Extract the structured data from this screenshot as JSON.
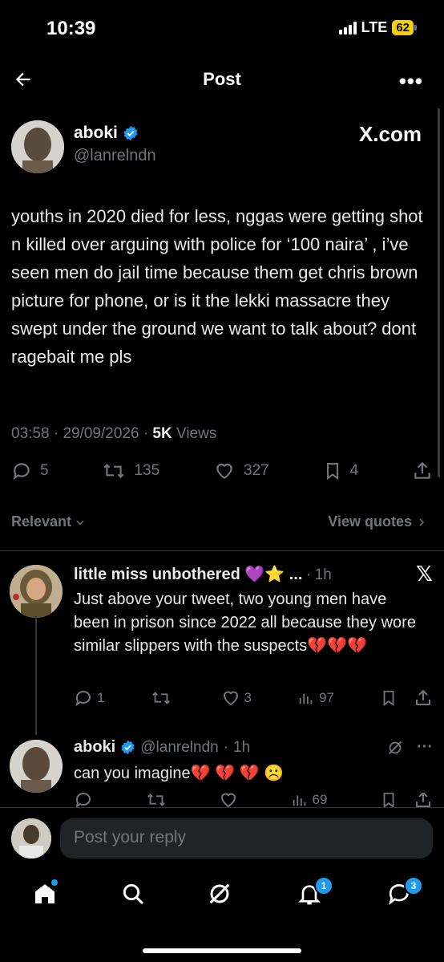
{
  "status": {
    "time": "10:39",
    "network": "LTE",
    "battery": "62"
  },
  "header": {
    "title": "Post"
  },
  "post": {
    "author_name": "aboki",
    "author_handle": "@lanrelndn",
    "source_badge": "X.com",
    "text": "youths in 2020 died for less, nggas were getting shot n killed over arguing with police for ‘100 naira’ , i’ve seen men do jail time because them get chris brown picture for phone, or is it the lekki massacre they swept under the ground we want to talk about? dont ragebait me pls",
    "time": "03:58",
    "date": "29/09/2026",
    "views_count": "5K",
    "views_label": "Views",
    "replies": "5",
    "reposts": "135",
    "likes": "327",
    "bookmarks": "4"
  },
  "sorting": {
    "relevant_label": "Relevant",
    "view_quotes_label": "View quotes"
  },
  "replies": [
    {
      "name": "little miss unbothered 💜⭐️ ...",
      "separator": "·",
      "time": "1h",
      "text": "Just above your tweet, two young men have been in prison since 2022 all because they wore similar slippers with the suspects💔💔💔",
      "replies": "1",
      "reposts": "",
      "likes": "3",
      "views": "97"
    },
    {
      "name": "aboki",
      "handle": "@lanrelndn",
      "separator": "·",
      "time": "1h",
      "text": "can you imagine💔 💔 💔 ☹️",
      "views": "69"
    }
  ],
  "compose": {
    "placeholder": "Post your reply"
  },
  "tabbar": {
    "notifications_badge": "1",
    "messages_badge": "3"
  },
  "colors": {
    "accent": "#1d9bf0",
    "muted": "#71767b",
    "battery": "#f5d000"
  }
}
